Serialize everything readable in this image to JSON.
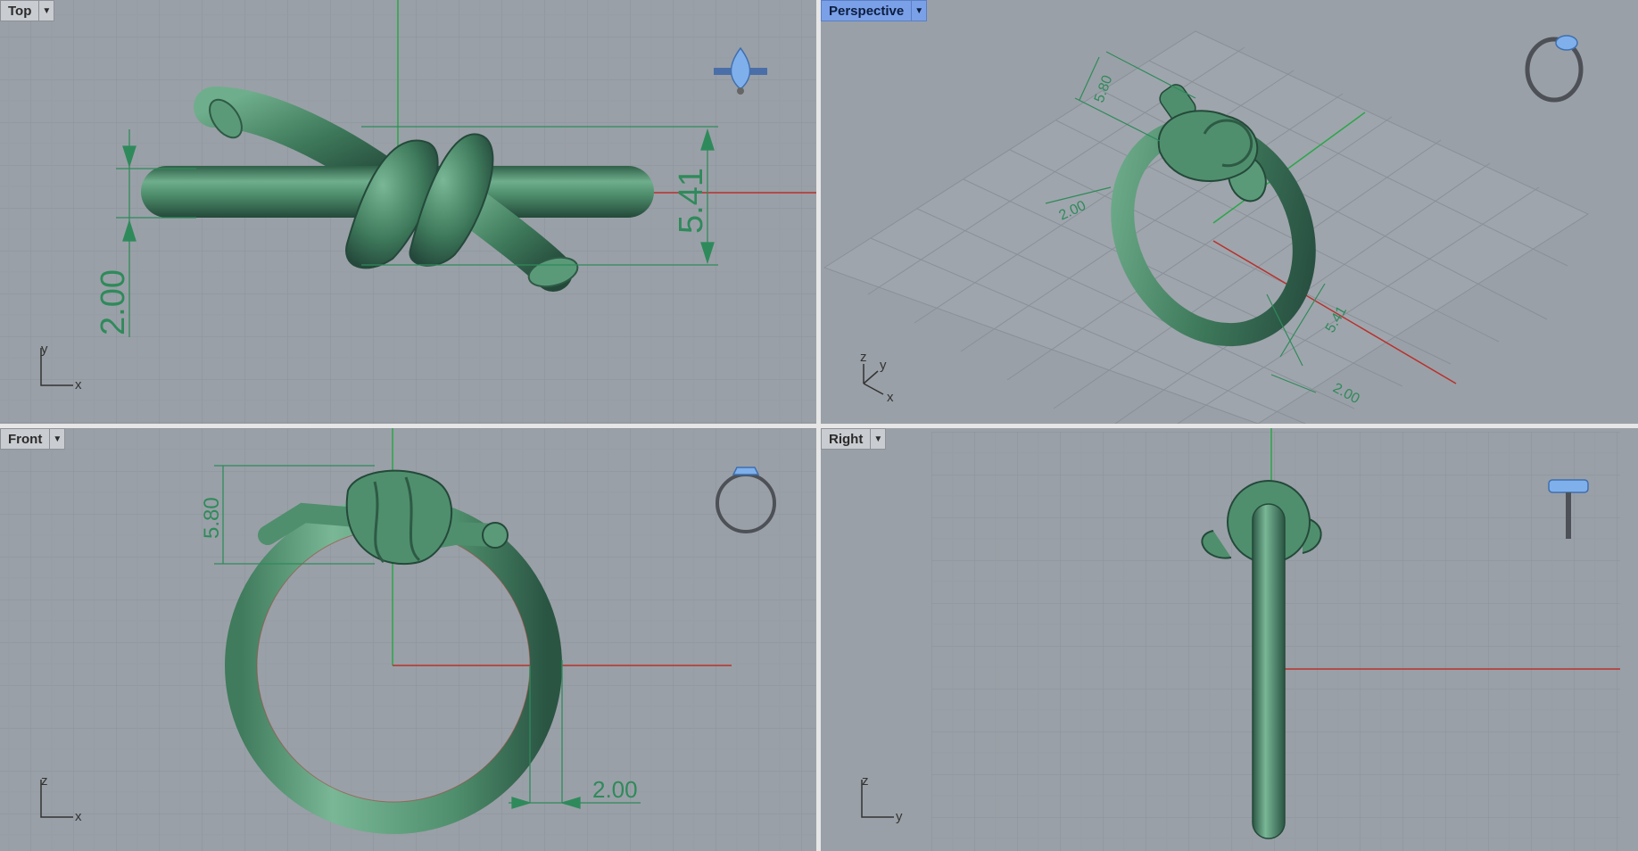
{
  "viewports": {
    "top": {
      "label": "Top",
      "dims": [
        "5.41",
        "2.00"
      ],
      "axes": [
        "y",
        "x"
      ]
    },
    "perspective": {
      "label": "Perspective",
      "dims": [
        "5.80",
        "2.00",
        "5.41",
        "2.00"
      ],
      "axes": [
        "z",
        "y",
        "x"
      ]
    },
    "front": {
      "label": "Front",
      "dims": [
        "5.80",
        "2.00"
      ],
      "axes": [
        "z",
        "x"
      ]
    },
    "right": {
      "label": "Right",
      "axes": [
        "z",
        "y"
      ]
    }
  },
  "colors": {
    "viewport_bg": "#9aa0a7",
    "grid": "#8c929a",
    "model": "#4b8a6a",
    "dimension": "#2f8a5b",
    "x_axis": "#b8302c",
    "y_axis": "#2aa64a",
    "active_tab": "#7aa0e8"
  }
}
